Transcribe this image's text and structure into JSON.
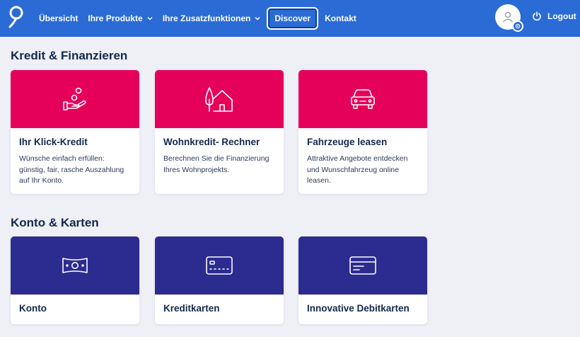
{
  "header": {
    "nav": [
      {
        "label": "Übersicht",
        "has_dropdown": false
      },
      {
        "label": "Ihre Produkte",
        "has_dropdown": true
      },
      {
        "label": "Ihre Zusatzfunktionen",
        "has_dropdown": true
      },
      {
        "label": "Discover",
        "has_dropdown": false,
        "active": true
      },
      {
        "label": "Kontakt",
        "has_dropdown": false
      }
    ],
    "logout_label": "Logout"
  },
  "sections": [
    {
      "title": "Kredit & Finanzieren",
      "cards": [
        {
          "icon": "hand-coins-icon",
          "title": "Ihr Klick-Kredit",
          "description": "Wünsche einfach erfüllen: günstig, fair, rasche Auszahlung auf Ihr Konto."
        },
        {
          "icon": "house-tree-icon",
          "title": "Wohnkredit- Rechner",
          "description": "Berechnen Sie die Finanzierung Ihres Wohnprojekts."
        },
        {
          "icon": "car-icon",
          "title": "Fahrzeuge leasen",
          "description": "Attraktive Angebote entdecken und Wunschfahrzeug online leasen."
        }
      ]
    },
    {
      "title": "Konto & Karten",
      "cards": [
        {
          "icon": "banknote-icon",
          "title": "Konto",
          "description": ""
        },
        {
          "icon": "credit-card-icon",
          "title": "Kreditkarten",
          "description": ""
        },
        {
          "icon": "debit-card-icon",
          "title": "Innovative Debitkarten",
          "description": ""
        }
      ]
    }
  ],
  "colors": {
    "header_blue": "#2a6bd6",
    "pink": "#e5005a",
    "navy": "#2c2b8f",
    "background": "#eef0f5",
    "text_dark": "#14284b"
  }
}
